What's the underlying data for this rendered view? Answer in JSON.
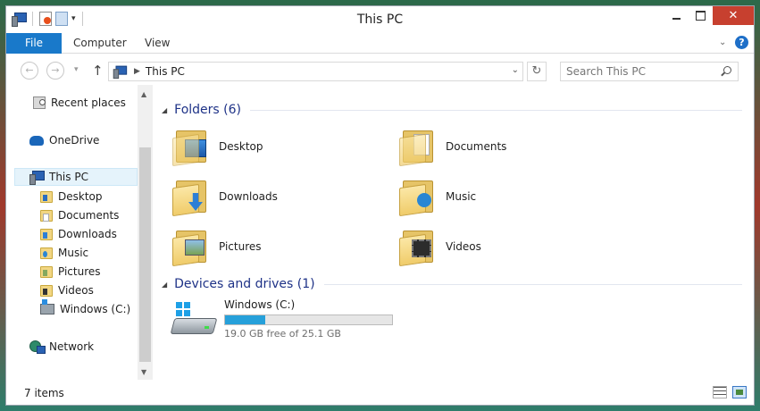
{
  "window": {
    "title": "This PC"
  },
  "ribbon": {
    "tabs": [
      {
        "label": "File"
      },
      {
        "label": "Computer"
      },
      {
        "label": "View"
      }
    ]
  },
  "address": {
    "crumb": "This PC"
  },
  "search": {
    "placeholder": "Search This PC"
  },
  "navpane": {
    "items": [
      {
        "label": "Recent places",
        "icon": "recent-places-icon"
      },
      {
        "label": "OneDrive",
        "icon": "onedrive-icon"
      },
      {
        "label": "This PC",
        "icon": "this-pc-icon",
        "selected": true
      },
      {
        "label": "Desktop",
        "icon": "desktop-folder-icon"
      },
      {
        "label": "Documents",
        "icon": "documents-folder-icon"
      },
      {
        "label": "Downloads",
        "icon": "downloads-folder-icon"
      },
      {
        "label": "Music",
        "icon": "music-folder-icon"
      },
      {
        "label": "Pictures",
        "icon": "pictures-folder-icon"
      },
      {
        "label": "Videos",
        "icon": "videos-folder-icon"
      },
      {
        "label": "Windows (C:)",
        "icon": "drive-icon"
      },
      {
        "label": "Network",
        "icon": "network-icon"
      }
    ]
  },
  "folders": {
    "header": "Folders (6)",
    "items": [
      {
        "label": "Desktop"
      },
      {
        "label": "Documents"
      },
      {
        "label": "Downloads"
      },
      {
        "label": "Music"
      },
      {
        "label": "Pictures"
      },
      {
        "label": "Videos"
      }
    ]
  },
  "devices": {
    "header": "Devices and drives (1)",
    "drive": {
      "name": "Windows (C:)",
      "free_text": "19.0 GB free of 25.1 GB",
      "used_fraction": 0.243
    }
  },
  "statusbar": {
    "count": "7 items"
  },
  "colors": {
    "accent": "#1979ca",
    "header_text": "#1e3287",
    "close_button": "#c7402f",
    "drive_bar": "#26a0da"
  }
}
